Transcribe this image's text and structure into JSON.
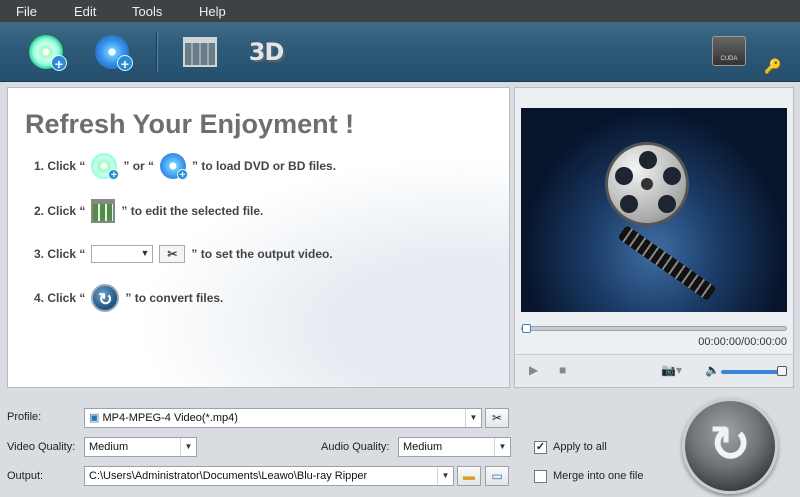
{
  "menu": {
    "file": "File",
    "edit": "Edit",
    "tools": "Tools",
    "help": "Help"
  },
  "toolbar": {
    "three_d": "3D",
    "cuda": "CUDA"
  },
  "guide": {
    "headline": "Refresh Your Enjoyment !",
    "step1_prefix": "1. Click “",
    "step1_mid": "” or “",
    "step1_suffix": "” to load DVD or BD files.",
    "step2_prefix": "2. Click “",
    "step2_suffix": "” to edit the selected file.",
    "step3_prefix": "3. Click “",
    "step3_suffix": "” to set the output video.",
    "step4_prefix": "4. Click “",
    "step4_suffix": "” to convert files."
  },
  "player": {
    "timecode": "00:00:00/00:00:00",
    "progress": 0,
    "volume": 1.0
  },
  "settings": {
    "profile_label": "Profile:",
    "profile_value": "MP4-MPEG-4 Video(*.mp4)",
    "video_quality_label": "Video Quality:",
    "video_quality_value": "Medium",
    "audio_quality_label": "Audio Quality:",
    "audio_quality_value": "Medium",
    "output_label": "Output:",
    "output_value": "C:\\Users\\Administrator\\Documents\\Leawo\\Blu-ray Ripper",
    "apply_to_all_label": "Apply to all",
    "apply_to_all_checked": true,
    "merge_label": "Merge into one file",
    "merge_checked": false
  }
}
